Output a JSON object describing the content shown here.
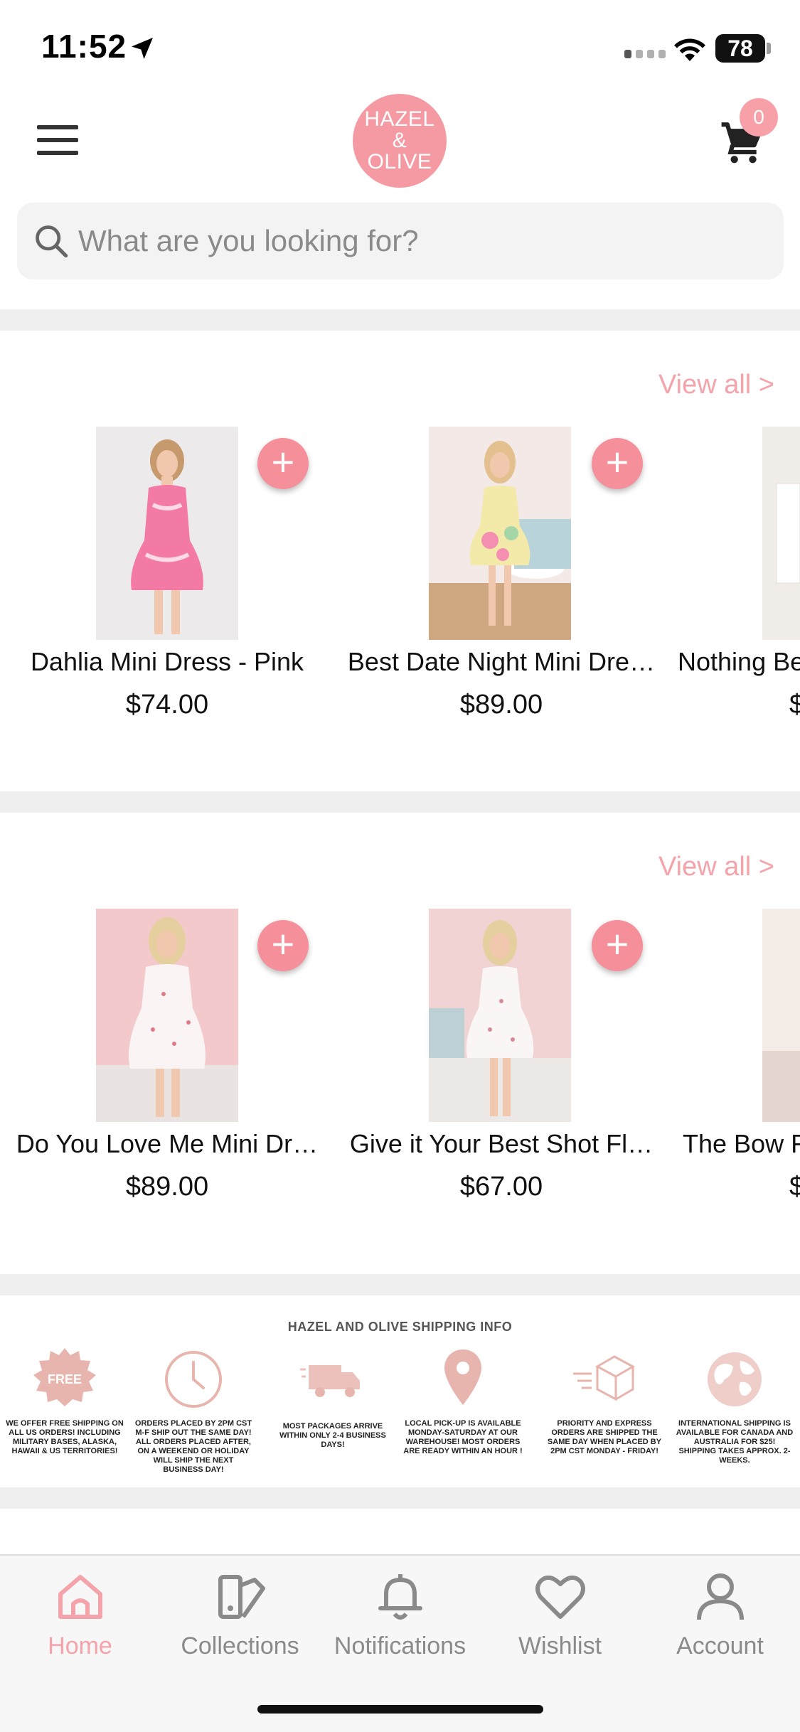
{
  "status_bar": {
    "time": "11:52",
    "battery": "78"
  },
  "header": {
    "logo_lines": [
      "HAZEL",
      "&",
      "OLIVE"
    ],
    "cart_count": "0"
  },
  "search": {
    "placeholder": "What are you looking for?"
  },
  "sections": [
    {
      "view_all": "View all >",
      "products": [
        {
          "name": "Dahlia Mini Dress - Pink",
          "price": "$74.00"
        },
        {
          "name": "Best Date Night Mini Dre…",
          "price": "$89.00"
        },
        {
          "name": "Nothing Be",
          "price": "$"
        }
      ]
    },
    {
      "view_all": "View all >",
      "products": [
        {
          "name": "Do You Love Me Mini Dr…",
          "price": "$89.00"
        },
        {
          "name": "Give it Your Best Shot Fl…",
          "price": "$67.00"
        },
        {
          "name": "The Bow F",
          "price": "$"
        }
      ]
    }
  ],
  "shipping": {
    "title": "HAZEL AND OLIVE SHIPPING INFO",
    "free_badge": "FREE",
    "items": [
      "WE OFFER FREE SHIPPING ON ALL US ORDERS! INCLUDING MILITARY BASES, ALASKA, HAWAII & US TERRITORIES!",
      "ORDERS PLACED BY 2PM CST M-F SHIP OUT THE SAME DAY! ALL ORDERS PLACED AFTER, ON A WEEKEND OR HOLIDAY WILL SHIP THE NEXT BUSINESS DAY!",
      "MOST PACKAGES ARRIVE WITHIN ONLY 2-4 BUSINESS DAYS!",
      "LOCAL PICK-UP IS AVAILABLE MONDAY-SATURDAY AT OUR WAREHOUSE! MOST ORDERS ARE READY WITHIN AN HOUR !",
      "PRIORITY AND EXPRESS ORDERS ARE SHIPPED THE SAME DAY WHEN PLACED BY 2PM CST MONDAY - FRIDAY!",
      "INTERNATIONAL SHIPPING IS AVAILABLE FOR CANADA AND AUSTRALIA FOR $25! SHIPPING TAKES APPROX. 2-WEEKS."
    ]
  },
  "tabs": [
    {
      "label": "Home",
      "icon": "home-icon",
      "active": true
    },
    {
      "label": "Collections",
      "icon": "collections-icon"
    },
    {
      "label": "Notifications",
      "icon": "bell-icon"
    },
    {
      "label": "Wishlist",
      "icon": "heart-icon"
    },
    {
      "label": "Account",
      "icon": "account-icon"
    }
  ],
  "colors": {
    "accent": "#f4a3ab",
    "logo": "#f59aa2",
    "add_button": "#f58f99"
  }
}
